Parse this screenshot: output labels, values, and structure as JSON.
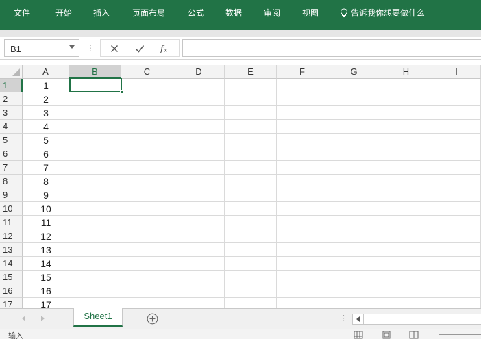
{
  "ribbon": {
    "tabs": [
      "文件",
      "开始",
      "插入",
      "页面布局",
      "公式",
      "数据",
      "审阅",
      "视图"
    ],
    "tell_me": "告诉我你想要做什么",
    "accent": "#217346"
  },
  "formula_bar": {
    "name_box": "B1",
    "separator": "⋮",
    "formula": ""
  },
  "grid": {
    "columns": [
      "A",
      "B",
      "C",
      "D",
      "E",
      "F",
      "G",
      "H",
      "I"
    ],
    "rows": [
      "1",
      "2",
      "3",
      "4",
      "5",
      "6",
      "7",
      "8",
      "9",
      "10",
      "11",
      "12",
      "13",
      "14",
      "15",
      "16",
      "17"
    ],
    "column_a_values": [
      "1",
      "2",
      "3",
      "4",
      "5",
      "6",
      "7",
      "8",
      "9",
      "10",
      "11",
      "12",
      "13",
      "14",
      "15",
      "16",
      "17"
    ],
    "active_cell": "B1"
  },
  "sheets": {
    "tabs": [
      "Sheet1"
    ],
    "active": "Sheet1",
    "separator": "⋮"
  },
  "statusbar": {
    "mode": "输入"
  },
  "icons": {
    "tell_me": "lightbulb-icon",
    "cancel": "close-icon",
    "enter": "check-icon",
    "function": "function-icon",
    "add_sheet": "plus-circle-icon"
  }
}
